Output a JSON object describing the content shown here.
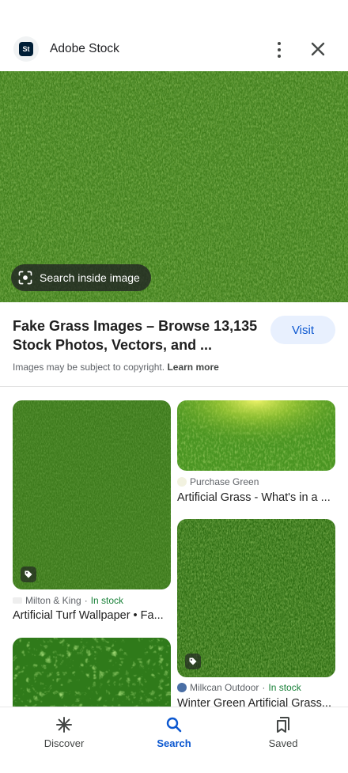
{
  "header": {
    "logo_text": "St",
    "site_name": "Adobe Stock",
    "icons": {
      "more": "more-vert-icon",
      "close": "close-icon"
    }
  },
  "hero": {
    "search_chip_label": "Search inside image",
    "search_chip_icon": "lens-icon"
  },
  "result": {
    "title": "Fake Grass Images – Browse 13,135 Stock Photos, Vectors, and ...",
    "visit_label": "Visit",
    "copyright_text": "Images may be subject to copyright.",
    "learn_more": "Learn more"
  },
  "related": [
    {
      "source": "Milton & King",
      "stock": "In stock",
      "title": "Artificial Turf Wallpaper • Fa..."
    },
    {
      "source": "Purchase Green",
      "stock": "",
      "title": "Artificial Grass - What's in a ..."
    },
    {
      "source": "Milkcan Outdoor",
      "stock": "In stock",
      "title": "Winter Green Artificial Grass..."
    }
  ],
  "related_separator": "·",
  "bottom_nav": [
    {
      "label": "Discover",
      "icon": "discover-asterisk-icon",
      "active": false
    },
    {
      "label": "Search",
      "icon": "search-icon",
      "active": true
    },
    {
      "label": "Saved",
      "icon": "bookmarks-icon",
      "active": false
    }
  ],
  "colors": {
    "accent": "#0b57d0",
    "in_stock": "#188038",
    "grass_dark": "#2f6b14",
    "grass_light": "#6aa92a"
  }
}
